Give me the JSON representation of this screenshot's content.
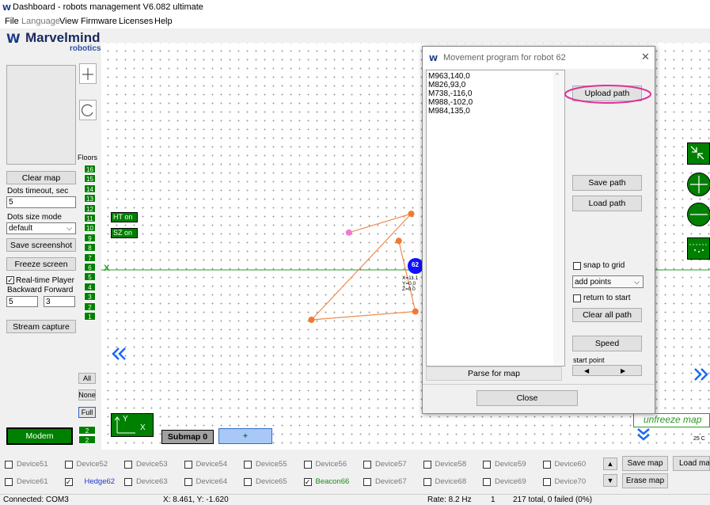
{
  "window": {
    "title": "Dashboard - robots management  V6.082  ultimate"
  },
  "menu": [
    "File",
    "Language",
    "View",
    "Firmware",
    "Licenses",
    "Help"
  ],
  "logo": {
    "brand": "Marvelmind",
    "sub": "robotics"
  },
  "left": {
    "clear_map": "Clear map",
    "dots_timeout_label": "Dots timeout, sec",
    "dots_timeout_value": "5",
    "dots_size_label": "Dots size mode",
    "dots_size_value": "default",
    "save_screenshot": "Save screenshot",
    "freeze_screen": "Freeze screen",
    "realtime_player": "Real-time Player",
    "backward_forward": "Backward Forward",
    "backward_value": "5",
    "forward_value": "3",
    "stream_capture": "Stream capture",
    "modem": "Modem"
  },
  "floors": {
    "label": "Floors",
    "items": [
      "16",
      "15",
      "14",
      "13",
      "12",
      "11",
      "10",
      "9",
      "8",
      "7",
      "6",
      "5",
      "4",
      "3",
      "2",
      "1"
    ],
    "all": "All",
    "none": "None",
    "full": "Full",
    "bottom": [
      "2",
      "2"
    ]
  },
  "map": {
    "ht_on": "HT on",
    "sz_on": "SZ on",
    "x_marker": "X",
    "axes_y": "Y",
    "axes_x": "X",
    "submap": "Submap 0",
    "add": "+",
    "beacon_label": "62",
    "beacon_coords": [
      "X=11.1",
      "Y=0.0",
      "Z=0.0"
    ],
    "unfreeze": "unfreeze map",
    "zoom_label": "25 C",
    "path_points": [
      {
        "x": 8.3,
        "y": 0.9
      },
      {
        "x": 9.5,
        "y": 0.7
      },
      {
        "x": 7.4,
        "y": -1.2
      },
      {
        "x": 9.9,
        "y": -1.0
      },
      {
        "x": 9.8,
        "y": 1.35
      }
    ]
  },
  "dialog": {
    "title": "Movement program for robot 62",
    "path_lines": [
      "M963,140,0",
      "M826,93,0",
      "M738,-116,0",
      "M988,-102,0",
      "M984,135,0"
    ],
    "upload_path": "Upload path",
    "save_path": "Save path",
    "load_path": "Load path",
    "snap_to_grid": "snap to grid",
    "add_points": "add points",
    "return_to_start": "return to start",
    "clear_all_path": "Clear all path",
    "speed": "Speed",
    "start_point": "start point",
    "parse_for_map": "Parse for map",
    "close": "Close"
  },
  "devices_row1": [
    "Device51",
    "Device52",
    "Device53",
    "Device54",
    "Device55",
    "Device56",
    "Device57",
    "Device58",
    "Device59",
    "Device60"
  ],
  "devices_row2": [
    "Device61",
    "Hedge62",
    "Device63",
    "Device64",
    "Device65",
    "Beacon66",
    "Device67",
    "Device68",
    "Device69",
    "Device70"
  ],
  "right_buttons": {
    "save_map": "Save map",
    "load_map": "Load map",
    "erase_map": "Erase map"
  },
  "status": {
    "connected": "Connected: COM3",
    "coords": "X: 8.461, Y: -1.620",
    "rate": "Rate: 8.2 Hz",
    "count": "1",
    "total": "217 total, 0 failed (0%)"
  },
  "colors": {
    "path": "#f08a50",
    "dot": "#f07a30",
    "pink": "#f07ad0",
    "floor_green": "#008000",
    "beacon_blue": "#1010ff",
    "highlight": "#e0309a"
  }
}
